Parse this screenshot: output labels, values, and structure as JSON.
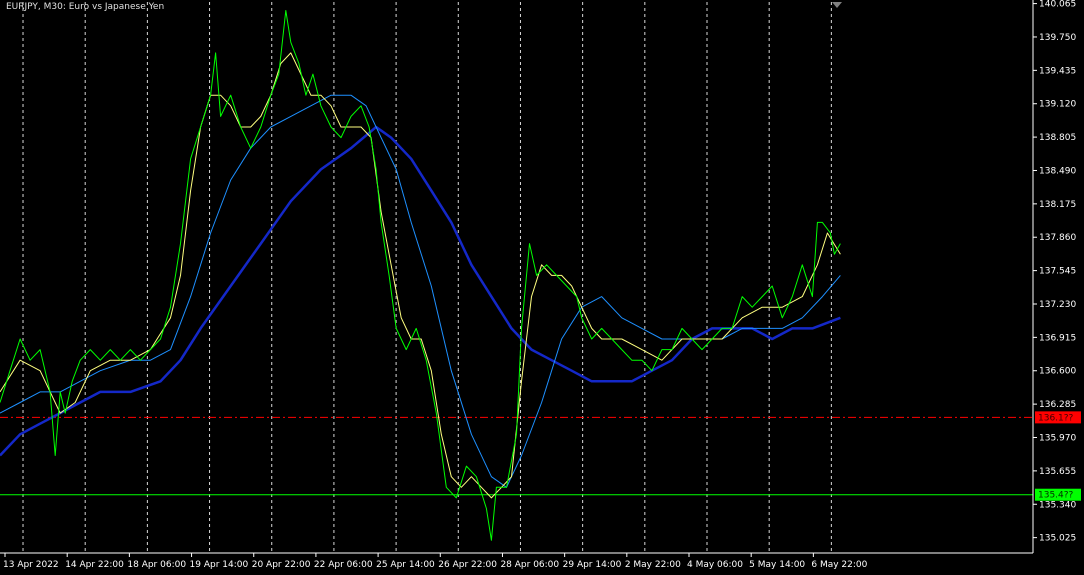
{
  "chart_title": "EURJPY, M30:  Euro vs Japanese Yen",
  "colors": {
    "background": "#000000",
    "grid": "#ffffff",
    "price": "#00ff00",
    "ma_fast": "#ffff80",
    "ma_medium": "#1e90ff",
    "ma_slow": "#1428c8",
    "level_red": "#ff0000",
    "level_green": "#00ff00",
    "axis_text": "#ffffff"
  },
  "chart_data": {
    "type": "line",
    "title": "EURJPY, M30:  Euro vs Japanese Yen",
    "ylim": [
      134.88,
      140.08
    ],
    "x_range": [
      0,
      1030
    ],
    "grid": true,
    "y_ticks": [
      "140.065",
      "139.750",
      "139.435",
      "139.120",
      "138.805",
      "138.490",
      "138.175",
      "137.860",
      "137.545",
      "137.230",
      "136.915",
      "136.600",
      "136.285",
      "135.970",
      "135.655",
      "135.340",
      "135.025"
    ],
    "x_ticks": [
      {
        "x": 5,
        "label": "13 Apr 2022"
      },
      {
        "x": 67,
        "label": "14 Apr 22:00"
      },
      {
        "x": 129,
        "label": "18 Apr 06:00"
      },
      {
        "x": 191,
        "label": "19 Apr 14:00"
      },
      {
        "x": 253,
        "label": "20 Apr 22:00"
      },
      {
        "x": 315,
        "label": "22 Apr 06:00"
      },
      {
        "x": 377,
        "label": "25 Apr 14:00"
      },
      {
        "x": 439,
        "label": "26 Apr 22:00"
      },
      {
        "x": 501,
        "label": "28 Apr 06:00"
      },
      {
        "x": 563,
        "label": "29 Apr 14:00"
      },
      {
        "x": 625,
        "label": "2 May 22:00"
      },
      {
        "x": 687,
        "label": "4 May 06:00"
      },
      {
        "x": 749,
        "label": "5 May 14:00"
      },
      {
        "x": 811,
        "label": "6 May 22:00"
      }
    ],
    "levels": [
      {
        "name": "red-level",
        "value": 136.16,
        "label": "136.1??",
        "style": "dashdot"
      },
      {
        "name": "green-level",
        "value": 135.43,
        "label": "135.4??",
        "style": "solid"
      }
    ],
    "series": [
      {
        "key": "price",
        "points": [
          [
            0,
            136.3
          ],
          [
            10,
            136.6
          ],
          [
            20,
            136.9
          ],
          [
            30,
            136.7
          ],
          [
            40,
            136.8
          ],
          [
            50,
            136.4
          ],
          [
            55,
            135.8
          ],
          [
            60,
            136.4
          ],
          [
            65,
            136.2
          ],
          [
            72,
            136.5
          ],
          [
            80,
            136.7
          ],
          [
            90,
            136.8
          ],
          [
            100,
            136.7
          ],
          [
            110,
            136.8
          ],
          [
            120,
            136.7
          ],
          [
            130,
            136.8
          ],
          [
            140,
            136.7
          ],
          [
            150,
            136.8
          ],
          [
            160,
            136.9
          ],
          [
            170,
            137.2
          ],
          [
            180,
            137.8
          ],
          [
            190,
            138.6
          ],
          [
            200,
            138.9
          ],
          [
            210,
            139.2
          ],
          [
            215,
            139.6
          ],
          [
            220,
            139.0
          ],
          [
            230,
            139.2
          ],
          [
            240,
            138.9
          ],
          [
            250,
            138.7
          ],
          [
            260,
            138.9
          ],
          [
            270,
            139.2
          ],
          [
            278,
            139.4
          ],
          [
            285,
            140.0
          ],
          [
            290,
            139.7
          ],
          [
            298,
            139.5
          ],
          [
            305,
            139.2
          ],
          [
            312,
            139.4
          ],
          [
            320,
            139.1
          ],
          [
            330,
            138.9
          ],
          [
            340,
            138.8
          ],
          [
            350,
            139.0
          ],
          [
            360,
            139.1
          ],
          [
            368,
            138.9
          ],
          [
            375,
            138.5
          ],
          [
            380,
            138.0
          ],
          [
            388,
            137.5
          ],
          [
            395,
            137.0
          ],
          [
            405,
            136.8
          ],
          [
            415,
            137.0
          ],
          [
            425,
            136.7
          ],
          [
            435,
            136.2
          ],
          [
            445,
            135.5
          ],
          [
            455,
            135.4
          ],
          [
            465,
            135.7
          ],
          [
            475,
            135.6
          ],
          [
            485,
            135.3
          ],
          [
            490,
            135.0
          ],
          [
            495,
            135.5
          ],
          [
            505,
            135.5
          ],
          [
            515,
            136.0
          ],
          [
            520,
            137.0
          ],
          [
            528,
            137.8
          ],
          [
            535,
            137.5
          ],
          [
            545,
            137.6
          ],
          [
            555,
            137.5
          ],
          [
            565,
            137.4
          ],
          [
            575,
            137.3
          ],
          [
            580,
            137.1
          ],
          [
            590,
            136.9
          ],
          [
            600,
            137.0
          ],
          [
            610,
            136.9
          ],
          [
            620,
            136.8
          ],
          [
            630,
            136.7
          ],
          [
            640,
            136.7
          ],
          [
            650,
            136.6
          ],
          [
            660,
            136.8
          ],
          [
            670,
            136.8
          ],
          [
            680,
            137.0
          ],
          [
            690,
            136.9
          ],
          [
            700,
            136.8
          ],
          [
            710,
            136.9
          ],
          [
            720,
            137.0
          ],
          [
            730,
            137.0
          ],
          [
            740,
            137.3
          ],
          [
            750,
            137.2
          ],
          [
            760,
            137.3
          ],
          [
            770,
            137.4
          ],
          [
            780,
            137.1
          ],
          [
            790,
            137.3
          ],
          [
            800,
            137.6
          ],
          [
            810,
            137.3
          ],
          [
            815,
            138.0
          ],
          [
            820,
            138.0
          ],
          [
            828,
            137.9
          ],
          [
            832,
            137.7
          ],
          [
            838,
            137.8
          ]
        ]
      },
      {
        "key": "ma_fast",
        "points": [
          [
            0,
            136.4
          ],
          [
            20,
            136.7
          ],
          [
            40,
            136.6
          ],
          [
            60,
            136.2
          ],
          [
            75,
            136.3
          ],
          [
            90,
            136.6
          ],
          [
            110,
            136.7
          ],
          [
            130,
            136.7
          ],
          [
            150,
            136.8
          ],
          [
            170,
            137.1
          ],
          [
            180,
            137.5
          ],
          [
            190,
            138.3
          ],
          [
            200,
            138.9
          ],
          [
            210,
            139.2
          ],
          [
            220,
            139.2
          ],
          [
            230,
            139.1
          ],
          [
            240,
            138.9
          ],
          [
            250,
            138.9
          ],
          [
            260,
            139.0
          ],
          [
            270,
            139.2
          ],
          [
            280,
            139.5
          ],
          [
            290,
            139.6
          ],
          [
            300,
            139.4
          ],
          [
            310,
            139.2
          ],
          [
            320,
            139.2
          ],
          [
            330,
            139.1
          ],
          [
            340,
            138.9
          ],
          [
            350,
            138.9
          ],
          [
            360,
            138.9
          ],
          [
            370,
            138.8
          ],
          [
            380,
            138.1
          ],
          [
            390,
            137.6
          ],
          [
            400,
            137.1
          ],
          [
            410,
            136.9
          ],
          [
            420,
            136.9
          ],
          [
            430,
            136.6
          ],
          [
            440,
            136.0
          ],
          [
            450,
            135.6
          ],
          [
            460,
            135.5
          ],
          [
            470,
            135.6
          ],
          [
            480,
            135.5
          ],
          [
            490,
            135.4
          ],
          [
            500,
            135.5
          ],
          [
            510,
            135.6
          ],
          [
            520,
            136.5
          ],
          [
            530,
            137.3
          ],
          [
            540,
            137.6
          ],
          [
            550,
            137.5
          ],
          [
            560,
            137.5
          ],
          [
            570,
            137.4
          ],
          [
            580,
            137.2
          ],
          [
            590,
            137.0
          ],
          [
            600,
            136.9
          ],
          [
            620,
            136.9
          ],
          [
            640,
            136.8
          ],
          [
            660,
            136.7
          ],
          [
            680,
            136.9
          ],
          [
            700,
            136.9
          ],
          [
            720,
            136.9
          ],
          [
            740,
            137.1
          ],
          [
            760,
            137.2
          ],
          [
            780,
            137.2
          ],
          [
            800,
            137.3
          ],
          [
            815,
            137.6
          ],
          [
            825,
            137.9
          ],
          [
            838,
            137.7
          ]
        ]
      },
      {
        "key": "ma_medium",
        "points": [
          [
            0,
            136.2
          ],
          [
            20,
            136.3
          ],
          [
            40,
            136.4
          ],
          [
            60,
            136.4
          ],
          [
            80,
            136.5
          ],
          [
            100,
            136.6
          ],
          [
            130,
            136.7
          ],
          [
            150,
            136.7
          ],
          [
            170,
            136.8
          ],
          [
            190,
            137.3
          ],
          [
            210,
            137.9
          ],
          [
            230,
            138.4
          ],
          [
            250,
            138.7
          ],
          [
            270,
            138.9
          ],
          [
            290,
            139.0
          ],
          [
            310,
            139.1
          ],
          [
            330,
            139.2
          ],
          [
            350,
            139.2
          ],
          [
            365,
            139.1
          ],
          [
            380,
            138.8
          ],
          [
            395,
            138.5
          ],
          [
            410,
            138.0
          ],
          [
            430,
            137.4
          ],
          [
            450,
            136.6
          ],
          [
            470,
            136.0
          ],
          [
            490,
            135.6
          ],
          [
            505,
            135.5
          ],
          [
            520,
            135.8
          ],
          [
            540,
            136.3
          ],
          [
            560,
            136.9
          ],
          [
            580,
            137.2
          ],
          [
            600,
            137.3
          ],
          [
            620,
            137.1
          ],
          [
            640,
            137.0
          ],
          [
            660,
            136.9
          ],
          [
            680,
            136.9
          ],
          [
            700,
            136.9
          ],
          [
            720,
            136.9
          ],
          [
            740,
            137.0
          ],
          [
            760,
            137.0
          ],
          [
            780,
            137.0
          ],
          [
            800,
            137.1
          ],
          [
            820,
            137.3
          ],
          [
            838,
            137.5
          ]
        ]
      },
      {
        "key": "ma_slow",
        "points": [
          [
            0,
            135.8
          ],
          [
            20,
            136.0
          ],
          [
            40,
            136.1
          ],
          [
            60,
            136.2
          ],
          [
            80,
            136.3
          ],
          [
            100,
            136.4
          ],
          [
            130,
            136.4
          ],
          [
            160,
            136.5
          ],
          [
            180,
            136.7
          ],
          [
            200,
            137.0
          ],
          [
            230,
            137.4
          ],
          [
            260,
            137.8
          ],
          [
            290,
            138.2
          ],
          [
            320,
            138.5
          ],
          [
            350,
            138.7
          ],
          [
            375,
            138.9
          ],
          [
            390,
            138.8
          ],
          [
            410,
            138.6
          ],
          [
            430,
            138.3
          ],
          [
            450,
            138.0
          ],
          [
            470,
            137.6
          ],
          [
            490,
            137.3
          ],
          [
            510,
            137.0
          ],
          [
            530,
            136.8
          ],
          [
            550,
            136.7
          ],
          [
            570,
            136.6
          ],
          [
            590,
            136.5
          ],
          [
            610,
            136.5
          ],
          [
            630,
            136.5
          ],
          [
            650,
            136.6
          ],
          [
            670,
            136.7
          ],
          [
            690,
            136.9
          ],
          [
            710,
            137.0
          ],
          [
            730,
            137.0
          ],
          [
            750,
            137.0
          ],
          [
            770,
            136.9
          ],
          [
            790,
            137.0
          ],
          [
            810,
            137.0
          ],
          [
            838,
            137.1
          ]
        ]
      }
    ]
  }
}
